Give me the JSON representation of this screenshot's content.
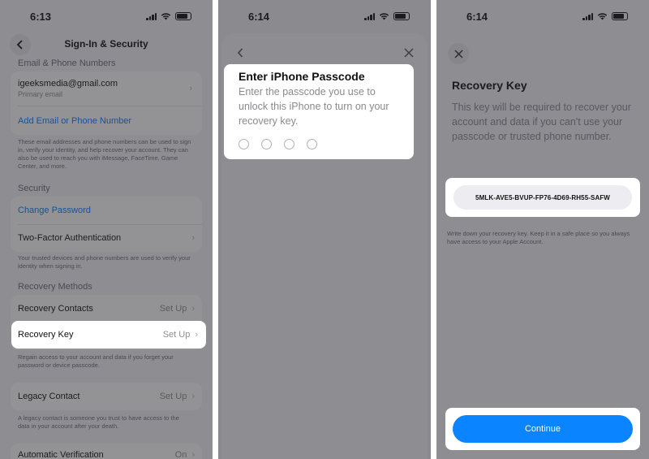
{
  "colors": {
    "accent": "#0a84ff",
    "link": "#0a7aff",
    "background": "#f2f2f7"
  },
  "screen1": {
    "time": "6:13",
    "nav_title": "Sign-In & Security",
    "email_section": "Email & Phone Numbers",
    "email": "igeeksmedia@gmail.com",
    "email_sub": "Primary email",
    "add_email": "Add Email or Phone Number",
    "email_footer": "These email addresses and phone numbers can be used to sign in, verify your identity, and help recover your account. They can also be used to reach you with iMessage, FaceTime, Game Center, and more.",
    "security_section": "Security",
    "change_password": "Change Password",
    "two_factor": "Two-Factor Authentication",
    "two_factor_footer": "Your trusted devices and phone numbers are used to verify your identity when signing in.",
    "recovery_section": "Recovery Methods",
    "recovery_contacts": "Recovery Contacts",
    "recovery_contacts_value": "Set Up",
    "recovery_key": "Recovery Key",
    "recovery_key_value": "Set Up",
    "recovery_footer": "Regain access to your account and data if you forget your password or device passcode.",
    "legacy_contact": "Legacy Contact",
    "legacy_value": "Set Up",
    "legacy_footer": "A legacy contact is someone you trust to have access to the data in your account after your death.",
    "auto_verification": "Automatic Verification",
    "auto_verification_value": "On"
  },
  "screen2": {
    "time": "6:14",
    "title": "Enter iPhone Passcode",
    "body": "Enter the passcode you use to unlock this iPhone to turn on your recovery key."
  },
  "screen3": {
    "time": "6:14",
    "title": "Recovery Key",
    "body": "This key will be required to recover your account and data if you can't use your passcode or trusted phone number.",
    "key": "5MLK-AVE5-BVUP-FP76-4D69-RH55-SAFW",
    "note": "Write down your recovery key. Keep it in a safe place so you always have access to your Apple Account.",
    "continue": "Continue"
  }
}
